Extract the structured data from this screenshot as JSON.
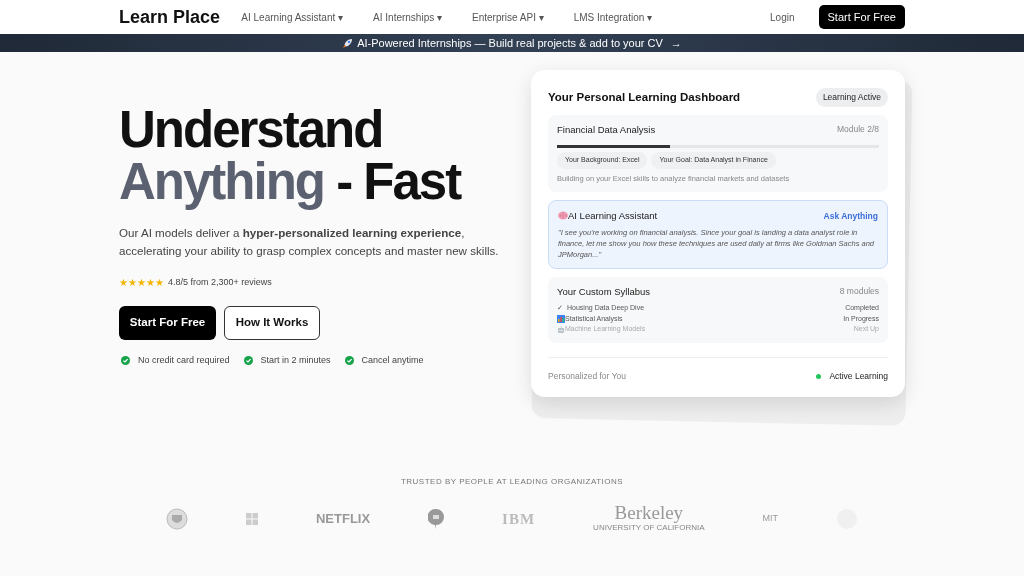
{
  "navbar": {
    "brand": "Learn Place",
    "menu": [
      {
        "label": "AI Learning Assistant",
        "caret": "▾"
      },
      {
        "label": "AI Internships",
        "caret": "▾"
      },
      {
        "label": "Enterprise API",
        "caret": "▾"
      },
      {
        "label": "LMS Integration",
        "caret": "▾"
      }
    ],
    "login": "Login",
    "cta": "Start For Free"
  },
  "banner": {
    "text": "AI-Powered Internships — Build real projects & add to your CV",
    "arrow": "→"
  },
  "hero": {
    "title_line_1": "Understand",
    "title_line_2_muted": "Anything",
    "title_line_2_rest": " - Fast",
    "subtitle": "Our AI models deliver a **hyper-personalized learning experience**, accelerating your ability to grasp complex concepts and master new skills.",
    "stars": 5,
    "rating": "4.8/5 from 2,300+ reviews",
    "primary_button": "Start For Free",
    "secondary_button": "How It Works",
    "perks": [
      "No credit card required",
      "Start in 2 minutes",
      "Cancel anytime"
    ]
  },
  "dashboard": {
    "title": "Your Personal Learning Dashboard",
    "badge": "Learning Active",
    "course": {
      "name": "Financial Data Analysis",
      "module": "Module 2/8",
      "level": 0.35,
      "tags": [
        "Your Background: Excel",
        "Your Goal: Data Analyst in Finance"
      ],
      "note": "Building on your Excel skills to analyze financial markets and datasets"
    },
    "assistant": {
      "title": "AI Learning Assistant",
      "link": "Ask Anything",
      "quote": "\"I see you're working on financial analysis. Since your goal is landing a data analyst role in finance, let me show you how these techniques are used daily at firms like Goldman Sachs and JPMorgan...\""
    },
    "syllabus": {
      "title": "Your Custom Syllabus",
      "count": "8 modules",
      "items": [
        {
          "kind": "completed",
          "mark": "✓",
          "name": "Housing Data Deep Dive",
          "status": "Completed"
        },
        {
          "kind": "in_progress",
          "name": "Statistical Analysis",
          "status": "In Progress"
        },
        {
          "kind": "upcoming",
          "name": "Machine Learning Models",
          "status": "Next Up"
        }
      ]
    },
    "footer_left": "Personalized for You",
    "footer_right": "Active Learning",
    "status_dot": {
      "color": "#22c55e"
    }
  },
  "trusted": {
    "heading": "TRUSTED BY PEOPLE AT LEADING ORGANIZATIONS",
    "logos": [
      {
        "kind": "seal"
      },
      {
        "kind": "squares"
      },
      {
        "kind": "wordmark",
        "text": "NETFLIX"
      },
      {
        "kind": "pin"
      },
      {
        "kind": "striped",
        "text": "IBM"
      },
      {
        "kind": "serif",
        "text": "Berkeley",
        "sub": "UNIVERSITY OF CALIFORNIA"
      },
      {
        "kind": "broken",
        "text": "MIT"
      },
      {
        "kind": "faded"
      }
    ]
  }
}
